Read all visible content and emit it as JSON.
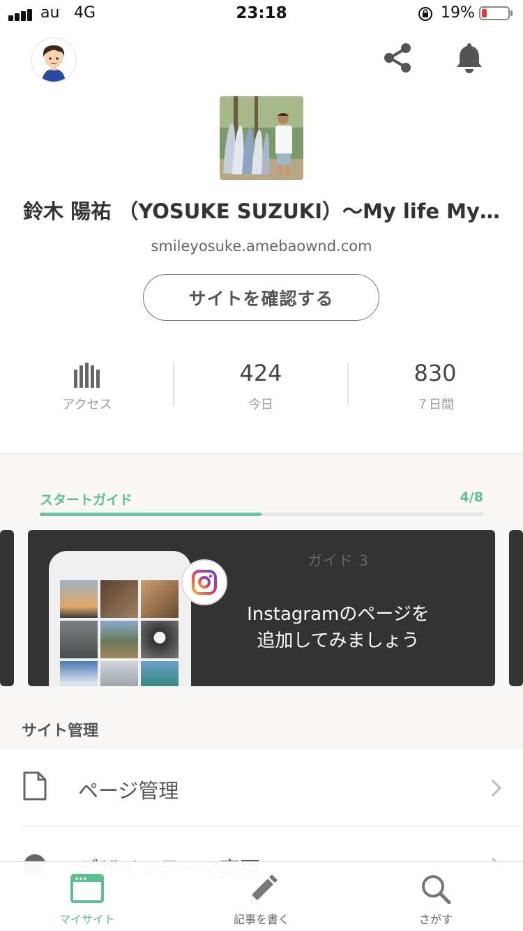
{
  "status_bar": {
    "carrier": "au",
    "network": "4G",
    "time": "23:18",
    "battery_percent_text": "19%",
    "battery_level": 0.19,
    "battery_color": "#e53935"
  },
  "header": {
    "avatar_icon": "user-avatar",
    "share_icon": "share-icon",
    "notification_icon": "bell-icon"
  },
  "site": {
    "title": "鈴木 陽祐 （YOSUKE SUZUKI）〜My life My…",
    "url": "smileyosuke.amebaownd.com",
    "confirm_button": "サイトを確認する"
  },
  "stats": {
    "access_label": "アクセス",
    "today_value": "424",
    "today_label": "今日",
    "week_value": "830",
    "week_label": "７日間"
  },
  "start_guide": {
    "label": "スタートガイド",
    "count_text": "4/8",
    "progress": 0.5,
    "accent_color": "#5bbf94",
    "card": {
      "guide_number": "ガイド 3",
      "line1": "Instagramのページを",
      "line2": "追加してみましょう"
    }
  },
  "site_management": {
    "heading": "サイト管理",
    "items": [
      {
        "label": "ページ管理",
        "icon": "page-icon"
      },
      {
        "label": "デザインテーマ変更",
        "icon": "palette-icon"
      }
    ]
  },
  "tabbar": {
    "tabs": [
      {
        "label": "マイサイト",
        "icon": "browser-window-icon",
        "active": true
      },
      {
        "label": "記事を書く",
        "icon": "pencil-icon",
        "active": false
      },
      {
        "label": "さがす",
        "icon": "search-icon",
        "active": false
      }
    ],
    "active_color": "#5bbf94"
  }
}
